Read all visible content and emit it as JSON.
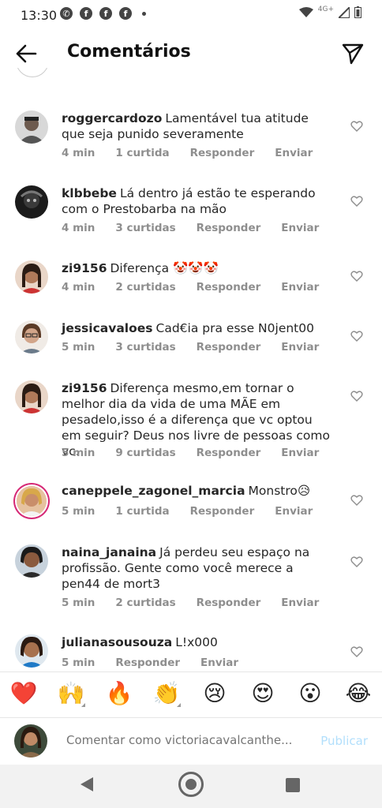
{
  "status_bar": {
    "time": "13:30",
    "network": "4G+",
    "notif_icons": [
      "whatsapp-icon",
      "facebook-icon",
      "facebook-icon",
      "facebook-icon"
    ]
  },
  "header": {
    "title": "Comentários"
  },
  "comments": [
    {
      "username": "roggercardozo",
      "text": "Lamentável tua atitude que seja punido severamente",
      "time": "4 min",
      "likes": "1 curtida",
      "reply": "Responder",
      "send": "Enviar"
    },
    {
      "username": "klbbebe",
      "text": "Lá dentro já estão te esperando com o Prestobarba na mão",
      "time": "4 min",
      "likes": "3 curtidas",
      "reply": "Responder",
      "send": "Enviar"
    },
    {
      "username": "zi9156",
      "text": "Diferença 🤡🤡🤡",
      "time": "4 min",
      "likes": "2 curtidas",
      "reply": "Responder",
      "send": "Enviar"
    },
    {
      "username": "jessicavaloes",
      "text": "Cad€ia pra esse N0jent00",
      "time": "5 min",
      "likes": "3 curtidas",
      "reply": "Responder",
      "send": "Enviar"
    },
    {
      "username": "zi9156",
      "text": "Diferença mesmo,em tornar o melhor dia da vida de uma MÃE  em pesadelo,isso é a diferença que vc optou em seguir? Deus nos livre de pessoas como vc.",
      "time": "5 min",
      "likes": "9 curtidas",
      "reply": "Responder",
      "send": "Enviar"
    },
    {
      "username": "caneppele_zagonel_marcia",
      "text": "Monstro😥",
      "time": "5 min",
      "likes": "1 curtida",
      "reply": "Responder",
      "send": "Enviar"
    },
    {
      "username": "naina_janaina",
      "text": "Já perdeu seu espaço na profissão. Gente como você merece a pen44 de mort3",
      "time": "5 min",
      "likes": "2 curtidas",
      "reply": "Responder",
      "send": "Enviar"
    },
    {
      "username": "julianasousouza",
      "text": "L!x000",
      "time": "5 min",
      "likes": "",
      "reply": "Responder",
      "send": "Enviar"
    }
  ],
  "emoji_bar": [
    "❤️",
    "🙌",
    "🔥",
    "👏",
    "😢",
    "😍",
    "😮",
    "😂"
  ],
  "composer": {
    "placeholder": "Comentar como victoriacavalcanthe...",
    "publish_label": "Publicar"
  },
  "colors": {
    "publish_disabled": "#b2dffc",
    "meta_gray": "#8e8e8e",
    "story_ring": "#d62976"
  }
}
